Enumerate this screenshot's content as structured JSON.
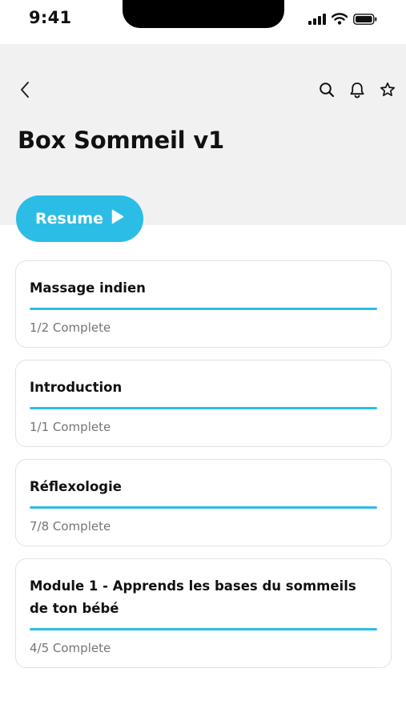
{
  "status_bar": {
    "time": "9:41",
    "icons": [
      "cellular-signal-icon",
      "wifi-icon",
      "battery-icon"
    ]
  },
  "header": {
    "back_icon": "chevron-left-icon",
    "actions": [
      "search-icon",
      "bell-icon",
      "star-icon"
    ],
    "title": "Box Sommeil v1"
  },
  "resume": {
    "label": "Resume",
    "icon": "play-icon"
  },
  "modules": [
    {
      "title": "Massage indien",
      "progress_text": "1/2 Complete",
      "progress": 1.0
    },
    {
      "title": "Introduction",
      "progress_text": "1/1 Complete",
      "progress": 1.0
    },
    {
      "title": "Réflexologie",
      "progress_text": "7/8 Complete",
      "progress": 1.0
    },
    {
      "title": "Module 1 - Apprends les bases du sommeils de ton bébé",
      "progress_text": "4/5 Complete",
      "progress": 1.0
    }
  ],
  "colors": {
    "accent": "#2bbde6",
    "header_background": "#f1f1f1",
    "card_border": "#e2e2e2",
    "muted_text": "#757575"
  }
}
